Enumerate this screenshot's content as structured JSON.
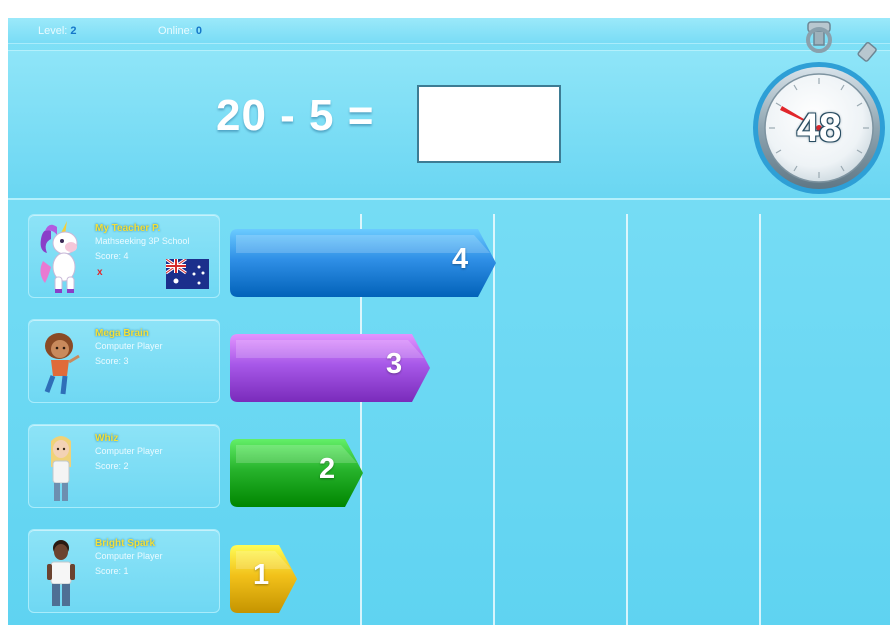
{
  "status_bar": {
    "level_label": "Level:",
    "level_value": "2",
    "online_label": "Online:",
    "online_value": "0"
  },
  "question": {
    "expression": "20 - 5 =",
    "answer_value": ""
  },
  "timer": {
    "seconds": "48"
  },
  "race": {
    "max_scale": 10,
    "bars": [
      {
        "value": "4",
        "score": 4,
        "color": "#2f8fe6"
      },
      {
        "value": "3",
        "score": 3,
        "color": "#a758e8"
      },
      {
        "value": "2",
        "score": 2,
        "color": "#27b32c"
      },
      {
        "value": "1",
        "score": 1,
        "color": "#f2c11a"
      }
    ]
  },
  "players": [
    {
      "name": "My Teacher P.",
      "subtitle": "Mathseeking 3P School",
      "score_text": "Score: 4",
      "mark": "x",
      "avatar_icon": "unicorn-avatar-icon",
      "flag_icon": "australia-flag-icon"
    },
    {
      "name": "Mega Brain",
      "subtitle": "Computer Player",
      "score_text": "Score: 3",
      "avatar_icon": "girl-avatar-icon"
    },
    {
      "name": "Whiz",
      "subtitle": "Computer Player",
      "score_text": "Score: 2",
      "avatar_icon": "blonde-girl-avatar-icon"
    },
    {
      "name": "Bright Spark",
      "subtitle": "Computer Player",
      "score_text": "Score: 1",
      "avatar_icon": "boy-avatar-icon"
    }
  ],
  "colors": {
    "background": "#6ad6f2",
    "name_text": "#f4e03a",
    "level_value": "#1577c9"
  }
}
